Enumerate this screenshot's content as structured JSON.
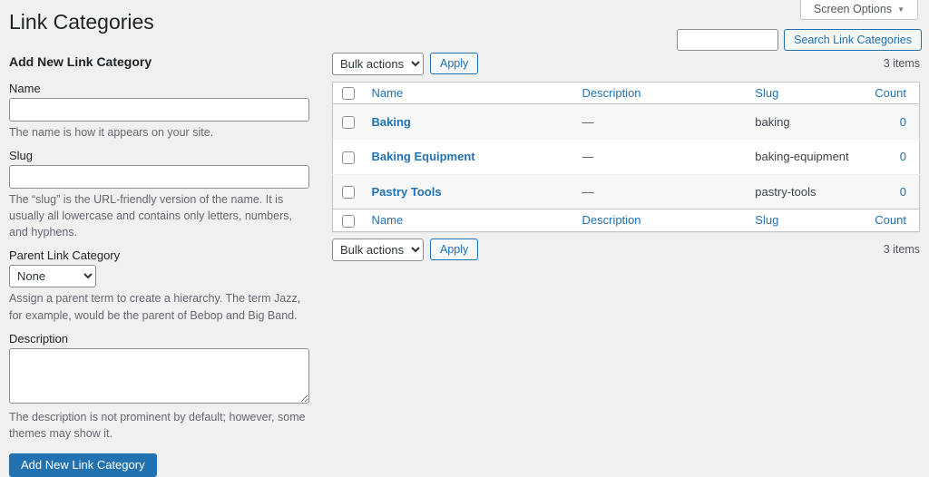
{
  "page": {
    "title": "Link Categories"
  },
  "screen_options": {
    "label": "Screen Options",
    "arrow": "▼"
  },
  "search": {
    "value": "",
    "button_label": "Search Link Categories"
  },
  "form": {
    "heading": "Add New Link Category",
    "name": {
      "label": "Name",
      "value": "",
      "help": "The name is how it appears on your site."
    },
    "slug": {
      "label": "Slug",
      "value": "",
      "help": "The “slug” is the URL-friendly version of the name. It is usually all lowercase and contains only letters, numbers, and hyphens."
    },
    "parent": {
      "label": "Parent Link Category",
      "selected": "None",
      "help": "Assign a parent term to create a hierarchy. The term Jazz, for example, would be the parent of Bebop and Big Band."
    },
    "description": {
      "label": "Description",
      "value": "",
      "help": "The description is not prominent by default; however, some themes may show it."
    },
    "submit_label": "Add New Link Category"
  },
  "table": {
    "bulk_actions_label": "Bulk actions",
    "apply_label": "Apply",
    "items_count": "3 items",
    "columns": [
      "Name",
      "Description",
      "Slug",
      "Count"
    ],
    "rows": [
      {
        "name": "Baking",
        "description": "—",
        "slug": "baking",
        "count": "0"
      },
      {
        "name": "Baking Equipment",
        "description": "—",
        "slug": "baking-equipment",
        "count": "0"
      },
      {
        "name": "Pastry Tools",
        "description": "—",
        "slug": "pastry-tools",
        "count": "0"
      }
    ]
  },
  "colors": {
    "accent": "#2271b1",
    "background": "#f0f0f1",
    "table_border": "#c3c4c7",
    "heading_text": "#1d2327",
    "help_text": "#646970"
  }
}
